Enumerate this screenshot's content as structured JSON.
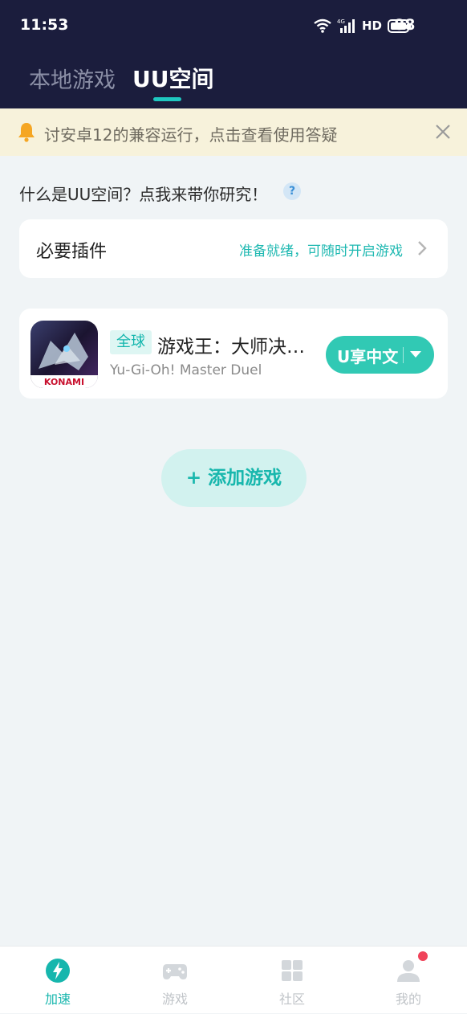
{
  "status_bar": {
    "time": "11:53",
    "network": "4G",
    "hd": "HD",
    "battery": "88"
  },
  "top_tabs": {
    "local": "本地游戏",
    "uu_space": "UU空间"
  },
  "notice": {
    "text": "讨安卓12的兼容运行，点击查看使用答疑"
  },
  "help_line": {
    "text": "什么是UU空间？点我来带你研究！",
    "help_glyph": "?"
  },
  "plugin": {
    "title": "必要插件",
    "status": "准备就绪，可随时开启游戏"
  },
  "game": {
    "region": "全球",
    "name": "游戏王：大师决…",
    "subtitle": "Yu-Gi-Oh! Master Duel",
    "icon_text": "KONAMI",
    "lang_button": "U享中文"
  },
  "add_game": {
    "label": "+ 添加游戏"
  },
  "bottom_nav": [
    {
      "label": "加速",
      "icon": "bolt-icon",
      "active": true
    },
    {
      "label": "游戏",
      "icon": "gamepad-icon",
      "active": false
    },
    {
      "label": "社区",
      "icon": "grid-icon",
      "active": false
    },
    {
      "label": "我的",
      "icon": "user-icon",
      "active": false,
      "badge": true
    }
  ],
  "colors": {
    "header_bg": "#1b1d3d",
    "accent": "#1fc7c0",
    "lang_button": "#31c9b4",
    "notice_bg": "#f7f2db",
    "badge_red": "#f0435a"
  }
}
